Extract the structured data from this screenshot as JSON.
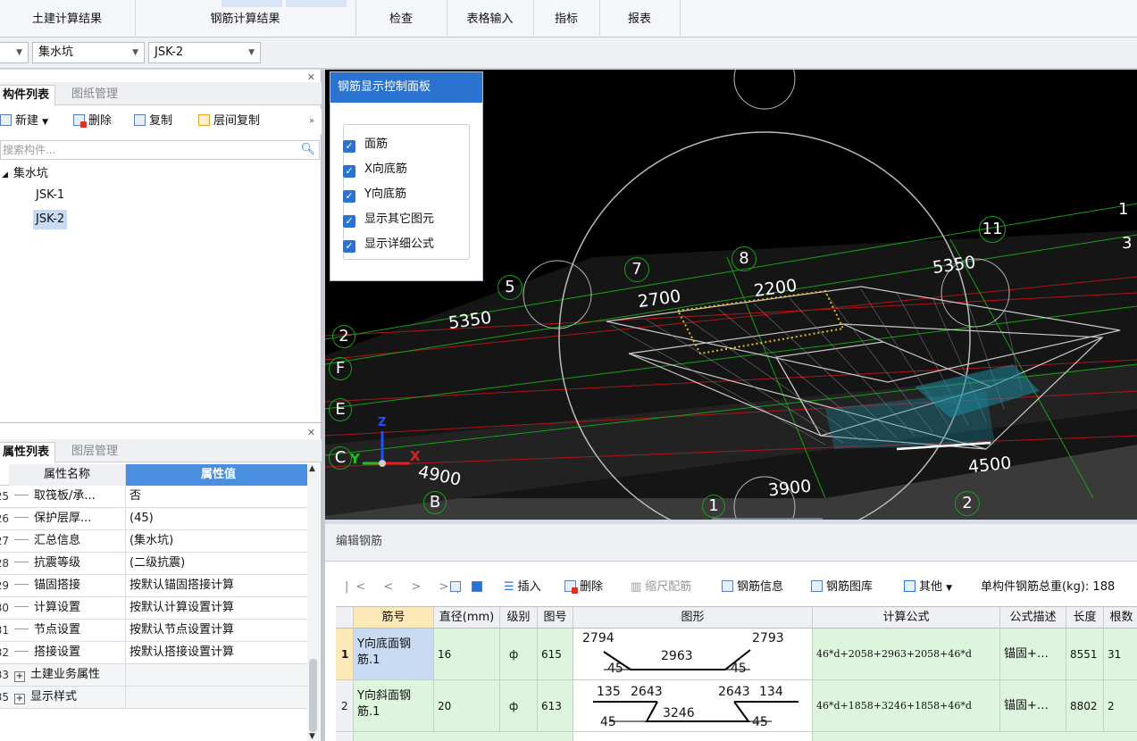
{
  "top_tabs": [
    "土建计算结果",
    "钢筋计算结果",
    "检查",
    "表格输入",
    "指标",
    "报表"
  ],
  "selectors": {
    "first": "",
    "second": "集水坑",
    "third": "JSK-2"
  },
  "component_panel": {
    "tabs": [
      "构件列表",
      "图纸管理"
    ],
    "toolbar": [
      "新建",
      "删除",
      "复制",
      "层间复制"
    ],
    "search_placeholder": "搜索构件...",
    "tree_root": "集水坑",
    "tree_items": [
      "JSK-1",
      "JSK-2"
    ]
  },
  "property_panel": {
    "tabs": [
      "属性列表",
      "图层管理"
    ],
    "header": {
      "name": "属性名称",
      "value": "属性值"
    },
    "rows": [
      {
        "num": "25",
        "name": "取筏板/承...",
        "value": "否"
      },
      {
        "num": "26",
        "name": "保护层厚...",
        "value": "(45)"
      },
      {
        "num": "27",
        "name": "汇总信息",
        "value": "(集水坑)"
      },
      {
        "num": "28",
        "name": "抗震等级",
        "value": "(二级抗震)"
      },
      {
        "num": "29",
        "name": "锚固搭接",
        "value": "按默认锚固搭接计算"
      },
      {
        "num": "30",
        "name": "计算设置",
        "value": "按默认计算设置计算"
      },
      {
        "num": "31",
        "name": "节点设置",
        "value": "按默认节点设置计算"
      },
      {
        "num": "32",
        "name": "搭接设置",
        "value": "按默认搭接设置计算"
      },
      {
        "num": "33",
        "name": "土建业务属性",
        "value": ""
      },
      {
        "num": "35",
        "name": "显示样式",
        "value": ""
      }
    ]
  },
  "control_panel": {
    "title": "钢筋显示控制面板",
    "options": [
      "面筋",
      "X向底筋",
      "Y向底筋",
      "显示其它图元",
      "显示详细公式"
    ]
  },
  "viewport": {
    "axis_labels": [
      "1",
      "2",
      "5",
      "7",
      "8",
      "11",
      "B",
      "C",
      "E",
      "F",
      "2",
      "1",
      "3"
    ],
    "dims": [
      "5350",
      "2700",
      "2200",
      "5350",
      "4900",
      "3900",
      "4500"
    ],
    "axis_letters": [
      "Y",
      "X",
      "Z"
    ]
  },
  "edit_panel": {
    "title": "编辑钢筋",
    "toolbar": [
      "插入",
      "删除",
      "缩尺配筋",
      "钢筋信息",
      "钢筋图库",
      "其他",
      "单构件钢筋总重(kg): 188"
    ],
    "columns": [
      "筋号",
      "直径(mm)",
      "级别",
      "图号",
      "图形",
      "计算公式",
      "公式描述",
      "长度",
      "根数"
    ],
    "rows": [
      {
        "idx": "1",
        "name": "Y向底面钢筋.1",
        "dia": "16",
        "grade": "ф",
        "fig": "615",
        "shape": {
          "l": "2794",
          "r": "2793",
          "mid": "2963",
          "bl": "45",
          "br": "45"
        },
        "formula": "46*d+2058+2963+2058+46*d",
        "desc": "锚固+…",
        "len": "8551",
        "count": "31"
      },
      {
        "idx": "2",
        "name": "Y向斜面钢筋.1",
        "dia": "20",
        "grade": "ф",
        "fig": "613",
        "shape": {
          "l": "135",
          "l2": "2643",
          "r2": "2643",
          "r": "134",
          "mid": "3246",
          "bl": "45",
          "br": "45"
        },
        "formula": "46*d+1858+3246+1858+46*d",
        "desc": "锚固+…",
        "len": "8802",
        "count": "2"
      }
    ]
  }
}
